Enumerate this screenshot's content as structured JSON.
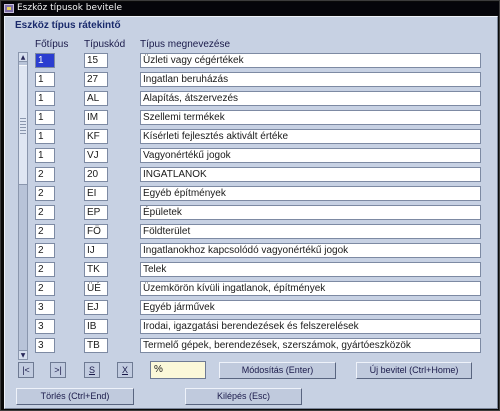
{
  "window": {
    "title": "Eszköz típusok bevitele"
  },
  "block": {
    "title": "Eszköz típus rátekintő"
  },
  "columns": {
    "main_type": "Főtípus",
    "type_code": "Típuskód",
    "type_name": "Típus megnevezése"
  },
  "rows": [
    {
      "main_type": "1",
      "code": "15",
      "name": "Üzleti vagy cégértékek",
      "selected": true
    },
    {
      "main_type": "1",
      "code": "27",
      "name": "Ingatlan beruházás"
    },
    {
      "main_type": "1",
      "code": "AL",
      "name": "Alapítás, átszervezés"
    },
    {
      "main_type": "1",
      "code": "IM",
      "name": "Szellemi termékek"
    },
    {
      "main_type": "1",
      "code": "KF",
      "name": "Kísérleti fejlesztés aktivált értéke"
    },
    {
      "main_type": "1",
      "code": "VJ",
      "name": "Vagyonértékű jogok"
    },
    {
      "main_type": "2",
      "code": "20",
      "name": "INGATLANOK"
    },
    {
      "main_type": "2",
      "code": "EI",
      "name": "Egyéb építmények"
    },
    {
      "main_type": "2",
      "code": "EP",
      "name": "Épületek"
    },
    {
      "main_type": "2",
      "code": "FÖ",
      "name": "Földterület"
    },
    {
      "main_type": "2",
      "code": "IJ",
      "name": "Ingatlanokhoz kapcsolódó vagyonértékű jogok"
    },
    {
      "main_type": "2",
      "code": "TK",
      "name": "Telek"
    },
    {
      "main_type": "2",
      "code": "ÜÉ",
      "name": "Üzemkörön kívüli ingatlanok, építmények"
    },
    {
      "main_type": "3",
      "code": "EJ",
      "name": "Egyéb járművek"
    },
    {
      "main_type": "3",
      "code": "IB",
      "name": "Irodai, igazgatási berendezések és felszerelések"
    },
    {
      "main_type": "3",
      "code": "TB",
      "name": "Termelő gépek, berendezések, szerszámok, gyártóeszközök"
    }
  ],
  "toolbar": {
    "first": "|<",
    "last": ">|",
    "search_letter": "S",
    "clear_letter": "X",
    "filter_value": "%",
    "modify_label": "Módosítás (Enter)",
    "new_label": "Új bevitel (Ctrl+Home)",
    "delete_label": "Törlés (Ctrl+End)",
    "exit_label": "Kilépés (Esc)"
  },
  "icons": {
    "window": "app-icon",
    "scroll_up": "arrow-up-icon",
    "scroll_down": "arrow-down-icon"
  },
  "colors": {
    "form_background": "#c7d1e3",
    "selection": "#2b3dd0",
    "filter_background": "#fbf8d9"
  }
}
